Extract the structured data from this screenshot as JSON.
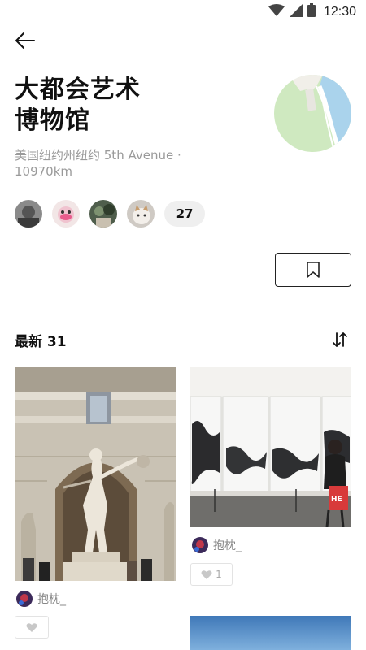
{
  "status_bar": {
    "time": "12:30"
  },
  "place": {
    "title_line1": "大都会艺术",
    "title_line2": "博物馆",
    "address_line1": "美国纽约州纽约 5th Avenue ·",
    "address_line2": "10970km"
  },
  "visitors": {
    "count": "27"
  },
  "posts_section": {
    "title": "最新 31"
  },
  "posts": [
    {
      "user": "抱枕_",
      "likes": ""
    },
    {
      "user": "抱枕_",
      "likes": "1"
    }
  ],
  "colors": {
    "map_green": "#cfe9c0",
    "map_water": "#aad3ec",
    "chip_bg": "#efefef"
  }
}
